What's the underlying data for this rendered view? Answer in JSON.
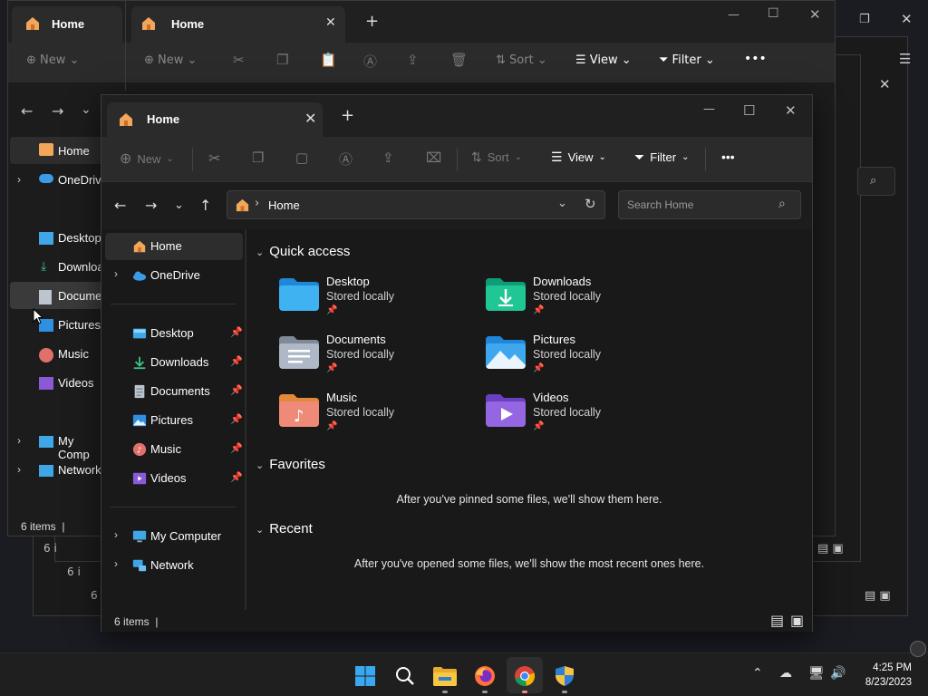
{
  "window": {
    "tab_title": "Home",
    "close_glyph": "✕",
    "new_tab_glyph": "+",
    "minimize_glyph": "—",
    "maximize_glyph": "☐",
    "window_close_glyph": "✕"
  },
  "toolbar": {
    "new_label": "New",
    "sort_label": "Sort",
    "view_label": "View",
    "filter_label": "Filter",
    "more_label": "•••"
  },
  "address": {
    "path": "Home",
    "search_placeholder": "Search Home"
  },
  "sidebar": {
    "items": [
      {
        "label": "Home"
      },
      {
        "label": "OneDrive"
      },
      {
        "label": "Desktop"
      },
      {
        "label": "Downloads"
      },
      {
        "label": "Documents"
      },
      {
        "label": "Pictures"
      },
      {
        "label": "Music"
      },
      {
        "label": "Videos"
      },
      {
        "label": "My Computer"
      },
      {
        "label": "Network"
      }
    ]
  },
  "content": {
    "quick_access_title": "Quick access",
    "favorites_title": "Favorites",
    "recent_title": "Recent",
    "favorites_empty": "After you've pinned some files, we'll show them here.",
    "recent_empty": "After you've opened some files, we'll show the most recent ones here.",
    "quick_access": [
      {
        "name": "Desktop",
        "sub": "Stored locally"
      },
      {
        "name": "Downloads",
        "sub": "Stored locally"
      },
      {
        "name": "Documents",
        "sub": "Stored locally"
      },
      {
        "name": "Pictures",
        "sub": "Stored locally"
      },
      {
        "name": "Music",
        "sub": "Stored locally"
      },
      {
        "name": "Videos",
        "sub": "Stored locally"
      }
    ]
  },
  "status": {
    "items_count": "6 items"
  },
  "background": {
    "tab_title_1": "Home",
    "tab_title_2": "Home",
    "new_label": "New",
    "sort_label": "Sort",
    "view_label": "View",
    "filter_label": "Filter",
    "items_count": "6 items",
    "items_partial": "6 i",
    "side": [
      "Home",
      "OneDrive",
      "Desktop",
      "Downloa",
      "Documen",
      "Pictures",
      "Music",
      "Videos",
      "My Comp",
      "Network"
    ]
  },
  "taskbar": {
    "time": "4:25 PM",
    "date": "8/23/2023"
  },
  "colors": {
    "accent": "#4cc2ff",
    "window_bg": "#191919",
    "toolbar_bg": "#2b2b2b"
  }
}
